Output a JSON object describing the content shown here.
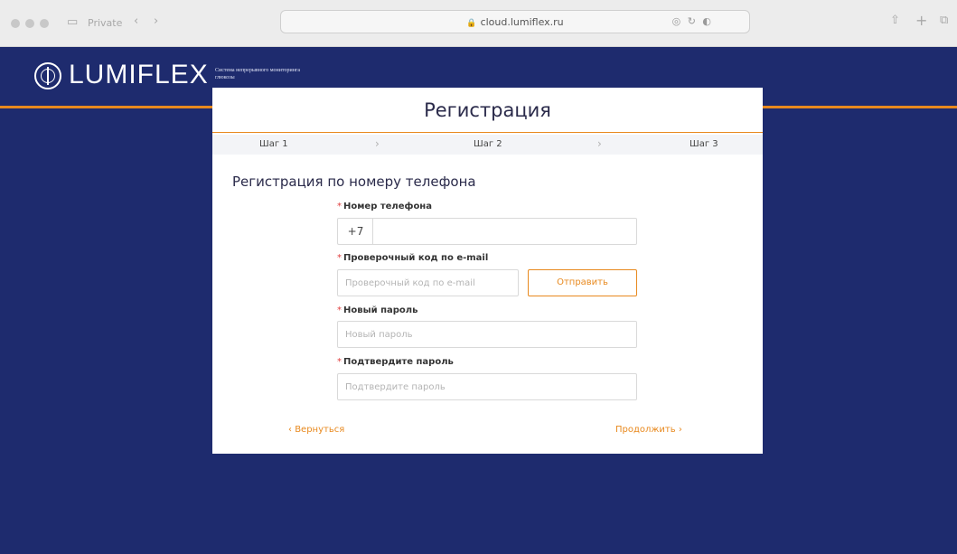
{
  "browser": {
    "private_label": "Private",
    "url": "cloud.lumiflex.ru"
  },
  "brand": {
    "name": "LUMIFLEX",
    "tagline": "Система непрерывного мониторинга глюкозы"
  },
  "card": {
    "title": "Регистрация",
    "steps": [
      "Шаг 1",
      "Шаг 2",
      "Шаг 3"
    ],
    "section_title": "Регистрация по номеру телефона"
  },
  "form": {
    "phone": {
      "label": "Номер телефона",
      "prefix": "+7",
      "value": ""
    },
    "email_code": {
      "label": "Проверочный код по e-mail",
      "placeholder": "Проверочный код по e-mail",
      "send_label": "Отправить"
    },
    "new_password": {
      "label": "Новый пароль",
      "placeholder": "Новый пароль"
    },
    "confirm_password": {
      "label": "Подтвердите пароль",
      "placeholder": "Подтвердите пароль"
    }
  },
  "nav": {
    "back_label": "Вернуться",
    "continue_label": "Продолжить"
  },
  "colors": {
    "page_bg": "#1e2b6e",
    "accent": "#e8891e"
  }
}
